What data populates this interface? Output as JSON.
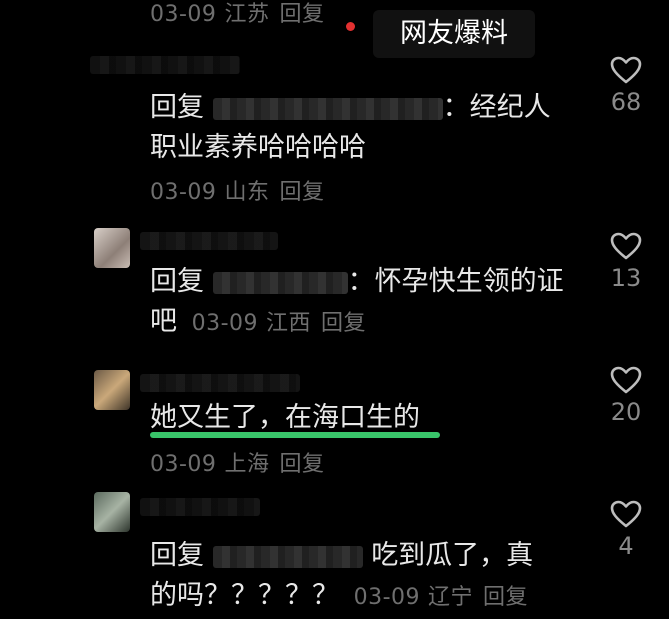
{
  "top_meta": {
    "date": "03-09",
    "location": "江苏",
    "reply": "回复"
  },
  "tag_label": "网友爆料",
  "comments": [
    {
      "reply_prefix": "回复",
      "text_line1": "：经纪人",
      "text_line2": "职业素养哈哈哈哈",
      "date": "03-09",
      "location": "山东",
      "reply": "回复",
      "likes": "68"
    },
    {
      "reply_prefix": "回复",
      "text_line1": "：怀孕快生领的证",
      "text_line2": "吧",
      "date": "03-09",
      "location": "江西",
      "reply": "回复",
      "likes": "13"
    },
    {
      "text_line1": "她又生了，在海口生的",
      "date": "03-09",
      "location": "上海",
      "reply": "回复",
      "likes": "20"
    },
    {
      "reply_prefix": "回复",
      "text_line1": "吃到瓜了，真",
      "text_line2": "的吗？？？？？",
      "date": "03-09",
      "location": "辽宁",
      "reply": "回复",
      "likes": "4"
    }
  ],
  "colors": {
    "highlight": "#39c46a",
    "tag_dot": "#e23030",
    "background": "#000000"
  }
}
